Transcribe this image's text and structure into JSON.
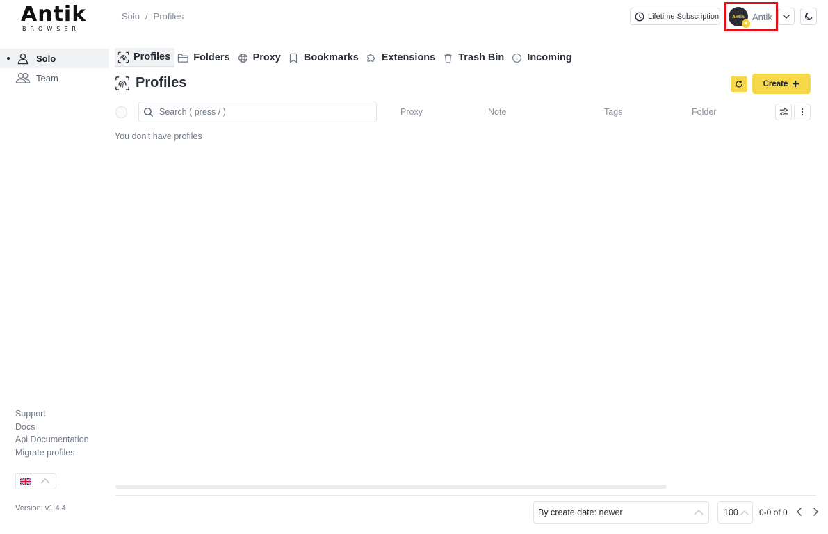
{
  "logo": {
    "word": "Antik",
    "sub": "BROWSER"
  },
  "sidebar": {
    "items": [
      {
        "label": "Solo",
        "icon": "user-icon",
        "active": true
      },
      {
        "label": "Team",
        "icon": "users-icon",
        "active": false
      }
    ],
    "links": [
      "Support",
      "Docs",
      "Api Documentation",
      "Migrate profiles"
    ],
    "version": "Version: v1.4.4"
  },
  "header": {
    "breadcrumb": [
      "Solo",
      "/",
      "Profiles"
    ],
    "subscription_label": "Lifetime Subscription",
    "user_name": "Antik",
    "avatar_text": "Antik"
  },
  "tabs": [
    {
      "label": "Profiles",
      "icon": "fingerprint-icon",
      "active": true
    },
    {
      "label": "Folders",
      "icon": "folder-icon",
      "active": false
    },
    {
      "label": "Proxy",
      "icon": "globe-icon",
      "active": false
    },
    {
      "label": "Bookmarks",
      "icon": "bookmark-icon",
      "active": false
    },
    {
      "label": "Extensions",
      "icon": "puzzle-icon",
      "active": false
    },
    {
      "label": "Trash Bin",
      "icon": "trash-icon",
      "active": false
    },
    {
      "label": "Incoming",
      "icon": "info-icon",
      "active": false
    }
  ],
  "main": {
    "title": "Profiles",
    "create_label": "Create",
    "search_placeholder": "Search ( press / )",
    "columns": [
      "Proxy",
      "Note",
      "Tags",
      "Folder"
    ],
    "empty_text": "You don't have profiles"
  },
  "footer": {
    "sort_value": "By create date: newer",
    "per_page": "100",
    "range": "0-0 of 0"
  },
  "colors": {
    "accent": "#f5d94a",
    "highlight_border": "#e0121c"
  }
}
